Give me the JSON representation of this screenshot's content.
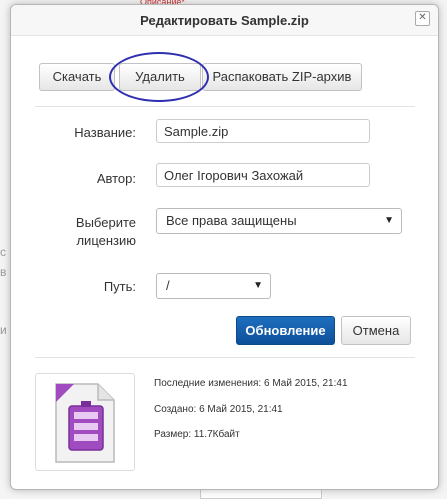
{
  "dialog": {
    "title": "Редактировать Sample.zip"
  },
  "toolbar": {
    "download": "Скачать",
    "delete": "Удалить",
    "unzip": "Распаковать ZIP-архив"
  },
  "form": {
    "name_label": "Название:",
    "name_value": "Sample.zip",
    "author_label": "Автор:",
    "author_value": "Олег Ігорович Захожай",
    "license_label_line1": "Выберите",
    "license_label_line2": "лицензию",
    "license_value": "Все права защищены",
    "path_label": "Путь:",
    "path_value": "/"
  },
  "actions": {
    "update": "Обновление",
    "cancel": "Отмена"
  },
  "details": {
    "modified": "Последние изменения:  6 Май 2015, 21:41",
    "created": "Создано:  6 Май 2015, 21:41",
    "size": "Размер:  11.7Кбайт"
  },
  "background": {
    "top_fragment": "Описание*"
  },
  "colors": {
    "primary_button": "#1e6fc0",
    "annotation_circle": "#2f2fb0",
    "zip_icon": "#a04cc0"
  },
  "icons": {
    "close": "close-icon",
    "file": "zip-file-icon",
    "dropdown": "dropdown-arrow-icon"
  }
}
